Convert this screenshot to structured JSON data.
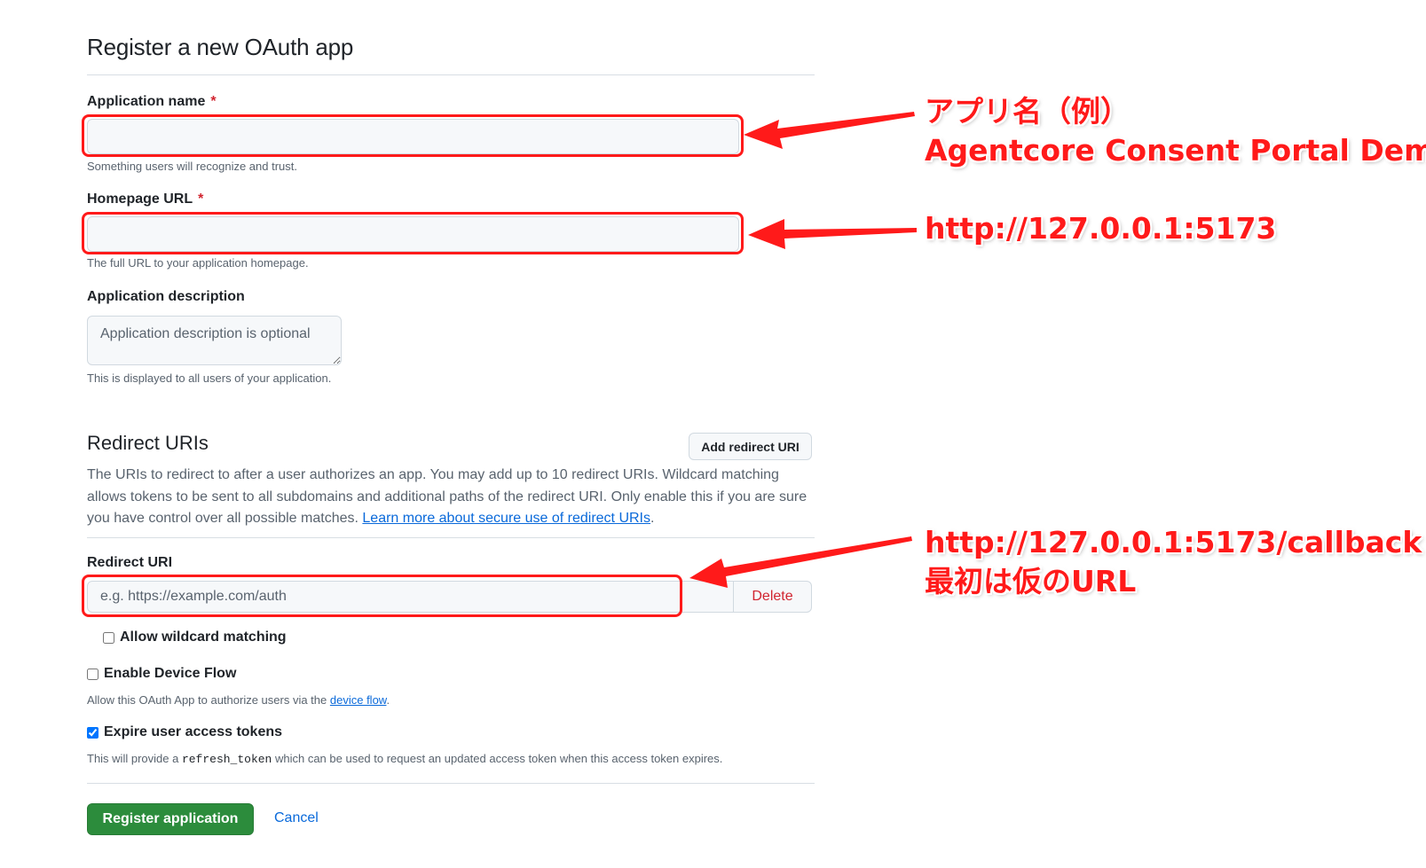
{
  "page": {
    "title": "Register a new OAuth app"
  },
  "app_name": {
    "label": "Application name",
    "required_mark": "*",
    "value": "",
    "note": "Something users will recognize and trust."
  },
  "homepage_url": {
    "label": "Homepage URL",
    "required_mark": "*",
    "value": "",
    "note": "The full URL to your application homepage."
  },
  "app_description": {
    "label": "Application description",
    "placeholder": "Application description is optional",
    "note": "This is displayed to all users of your application."
  },
  "redirect_uris": {
    "title": "Redirect URIs",
    "add_button": "Add redirect URI",
    "description": "The URIs to redirect to after a user authorizes an app. You may add up to 10 redirect URIs. Wildcard matching allows tokens to be sent to all subdomains and additional paths of the redirect URI. Only enable this if you are sure you have control over all possible matches.",
    "link_text": "Learn more about secure use of redirect URIs",
    "link_suffix": ".",
    "uri_label": "Redirect URI",
    "uri_placeholder": "e.g. https://example.com/auth",
    "delete_button": "Delete",
    "wildcard_label": "Allow wildcard matching",
    "wildcard_checked": false
  },
  "device_flow": {
    "label": "Enable Device Flow",
    "checked": false,
    "note_prefix": "Allow this OAuth App to authorize users via the ",
    "note_link": "device flow",
    "note_suffix": "."
  },
  "expire_tokens": {
    "label": "Expire user access tokens",
    "checked": true,
    "note_prefix": "This will provide a ",
    "note_code": "refresh_token",
    "note_suffix": " which can be used to request an updated access token when this access token expires."
  },
  "actions": {
    "register": "Register application",
    "cancel": "Cancel"
  },
  "annotations": {
    "app_name_line1": "アプリ名（例）",
    "app_name_line2": "Agentcore Consent Portal Demo",
    "homepage_url": "http://127.0.0.1:5173",
    "redirect_line1": "http://127.0.0.1:5173/callback",
    "redirect_line2": "最初は仮のURL"
  },
  "colors": {
    "annotation_red": "#ff1a1a",
    "primary_green": "#2c8c3c",
    "link_blue": "#0969da",
    "danger_red": "#d1242f"
  }
}
